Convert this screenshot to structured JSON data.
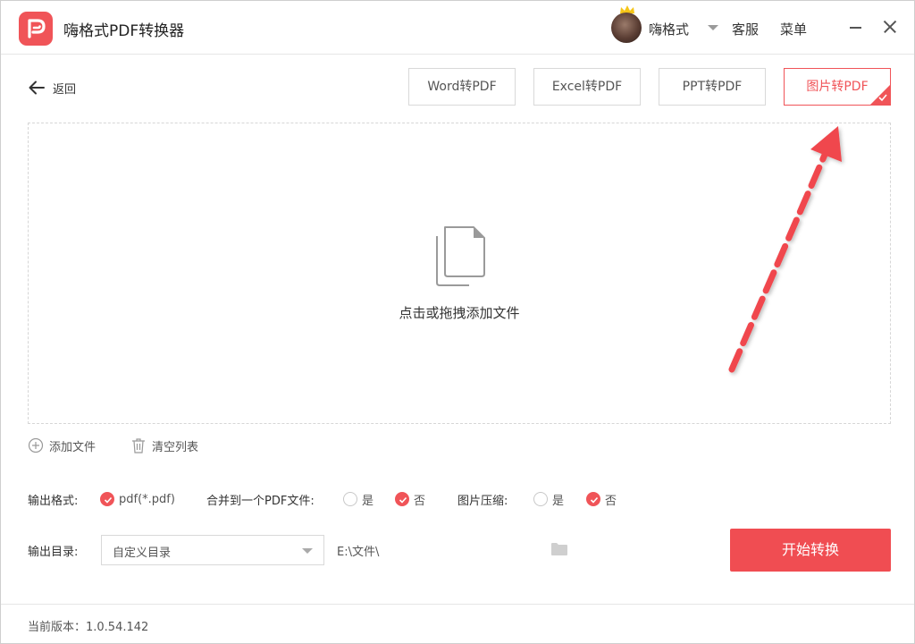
{
  "app": {
    "title": "嗨格式PDF转换器",
    "brand_color": "#f05458",
    "logo_icon": "pdf-logo-icon"
  },
  "header": {
    "username": "嗨格式",
    "service_label": "客服",
    "menu_label": "菜单"
  },
  "nav": {
    "back_label": "返回",
    "tabs": [
      {
        "label": "Word转PDF",
        "active": false
      },
      {
        "label": "Excel转PDF",
        "active": false
      },
      {
        "label": "PPT转PDF",
        "active": false
      },
      {
        "label": "图片转PDF",
        "active": true
      }
    ]
  },
  "dropzone": {
    "hint": "点击或拖拽添加文件",
    "icon": "document-icon"
  },
  "file_actions": {
    "add_label": "添加文件",
    "clear_label": "清空列表"
  },
  "options": {
    "format_label": "输出格式:",
    "format_value": "pdf(*.pdf)",
    "merge_label": "合并到一个PDF文件:",
    "merge_yes": "是",
    "merge_no": "否",
    "merge_selected": "否",
    "compress_label": "图片压缩:",
    "compress_yes": "是",
    "compress_no": "否",
    "compress_selected": "否"
  },
  "output": {
    "dir_label": "输出目录:",
    "dir_select_value": "自定义目录",
    "dir_path": "E:\\文件\\",
    "start_label": "开始转换"
  },
  "footer": {
    "version_label": "当前版本：1.0.54.142"
  }
}
